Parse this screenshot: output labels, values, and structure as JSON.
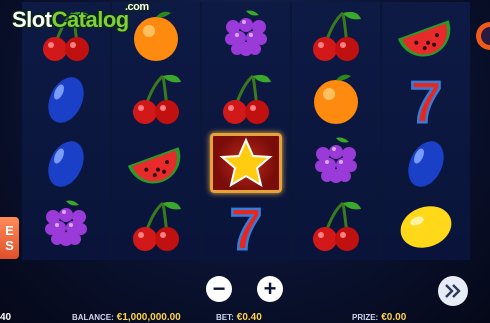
{
  "logo": {
    "part1": "Slot",
    "part2": "Catalog",
    "suffix": ".com"
  },
  "side_tab": {
    "line1": "E",
    "line2": "S"
  },
  "reels": [
    [
      "cherry",
      "plum",
      "plum",
      "grapes"
    ],
    [
      "orange",
      "cherry",
      "watermelon",
      "cherry"
    ],
    [
      "grapes",
      "cherry",
      "star",
      "seven"
    ],
    [
      "cherry",
      "orange",
      "grapes",
      "cherry"
    ],
    [
      "watermelon",
      "seven",
      "plum",
      "lemon"
    ]
  ],
  "controls": {
    "minus_label": "−",
    "plus_label": "+",
    "spin_icon": "fast-forward-icon"
  },
  "bottom": {
    "left_fragment": "40",
    "balance_label": "BALANCE:",
    "balance_value": "€1,000,000.00",
    "bet_label": "BET:",
    "bet_value": "€0.40",
    "prize_label": "PRIZE:",
    "prize_value": "€0.00"
  },
  "colors": {
    "accent": "#ffd24a",
    "highlight_border": "#e8a23a",
    "background": "#0a1230"
  }
}
